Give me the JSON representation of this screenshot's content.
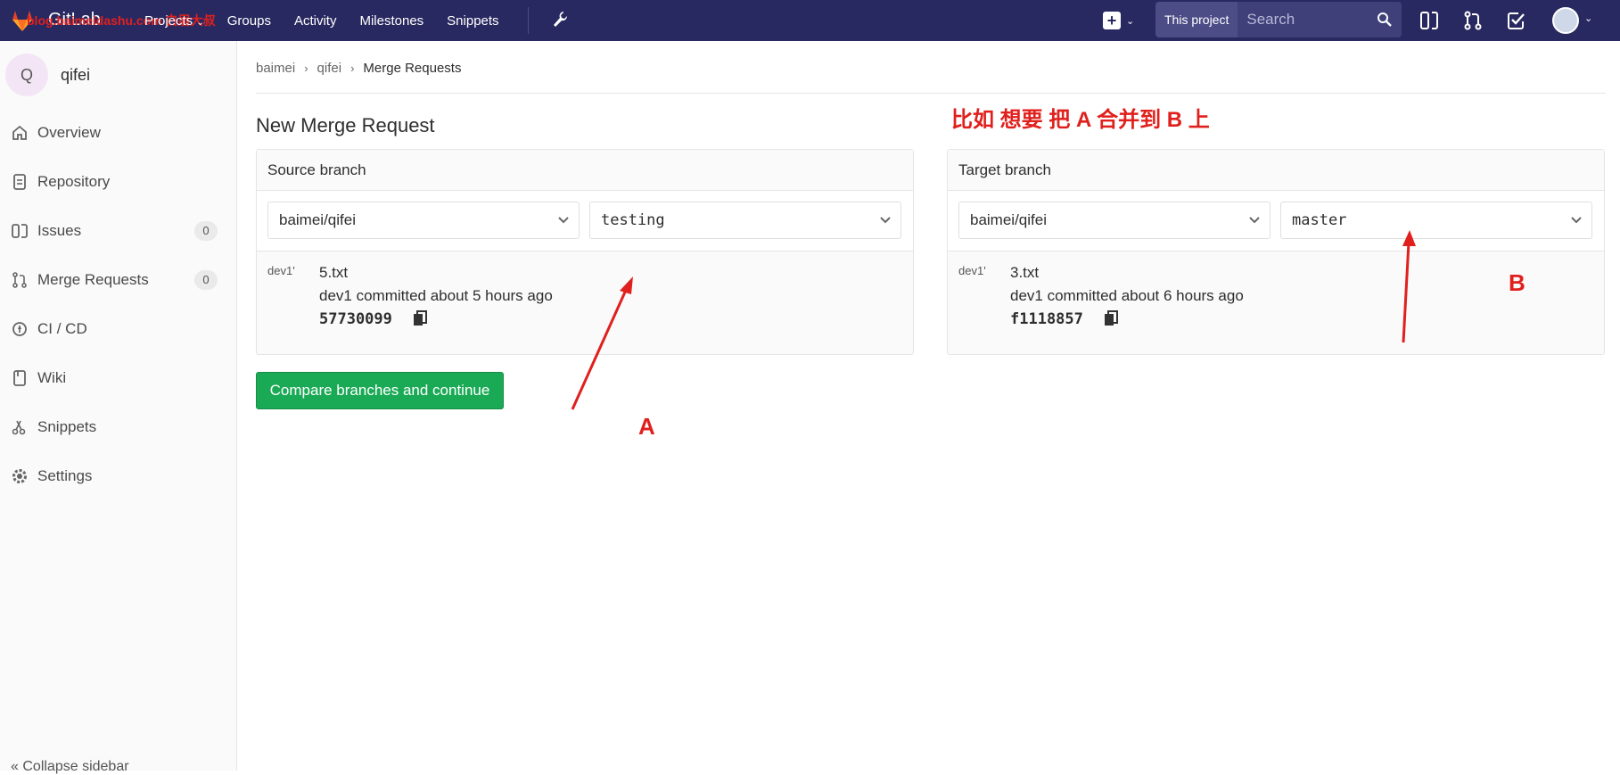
{
  "header": {
    "brand": "GitLab",
    "watermark": "blog.baimeidashu.com 白眉大叔",
    "nav": [
      "Projects",
      "Groups",
      "Activity",
      "Milestones",
      "Snippets"
    ],
    "search_scope": "This project",
    "search_placeholder": "Search",
    "colors": {
      "bar": "#292961",
      "accent": "#1aaa55",
      "annotation": "#e0201d"
    }
  },
  "sidebar": {
    "project_initial": "Q",
    "project_name": "qifei",
    "items": [
      {
        "label": "Overview",
        "icon": "home-icon"
      },
      {
        "label": "Repository",
        "icon": "doc-icon"
      },
      {
        "label": "Issues",
        "icon": "issues-icon",
        "count": "0"
      },
      {
        "label": "Merge Requests",
        "icon": "merge-request-icon",
        "count": "0"
      },
      {
        "label": "CI / CD",
        "icon": "rocket-icon"
      },
      {
        "label": "Wiki",
        "icon": "book-icon"
      },
      {
        "label": "Snippets",
        "icon": "scissors-icon"
      },
      {
        "label": "Settings",
        "icon": "gear-icon"
      }
    ],
    "collapse_label": "Collapse sidebar"
  },
  "breadcrumb": [
    "baimei",
    "qifei",
    "Merge Requests"
  ],
  "page_title": "New Merge Request",
  "annotation_text": "比如 想要 把 A 合并到 B 上",
  "source": {
    "heading": "Source branch",
    "project": "baimei/qifei",
    "branch": "testing",
    "commit_avatar_alt": "dev1'",
    "commit_title": "5.txt",
    "commit_meta": "dev1 committed about 5 hours ago",
    "commit_sha": "57730099"
  },
  "target": {
    "heading": "Target branch",
    "project": "baimei/qifei",
    "branch": "master",
    "commit_avatar_alt": "dev1'",
    "commit_title": "3.txt",
    "commit_meta": "dev1 committed about 6 hours ago",
    "commit_sha": "f1118857"
  },
  "compare_button": "Compare branches and continue",
  "marks": {
    "a": "A",
    "b": "B"
  }
}
